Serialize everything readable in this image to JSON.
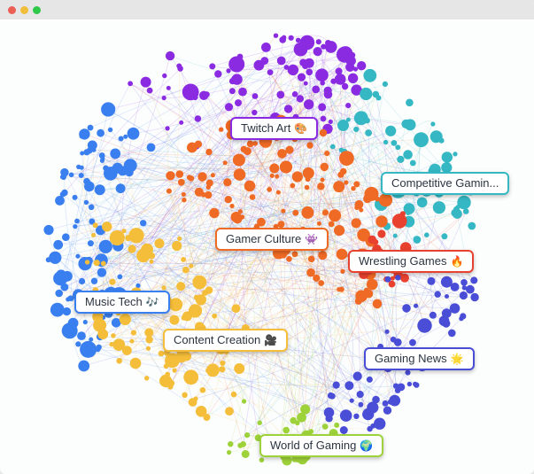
{
  "window": {
    "controls": [
      "close",
      "minimize",
      "maximize"
    ]
  },
  "clusters": [
    {
      "id": "twitch-art",
      "label": "Twitch Art",
      "emoji": "🎨",
      "color": "#8a2be2"
    },
    {
      "id": "competitive-gaming",
      "label": "Competitive Gamin...",
      "emoji": "",
      "color": "#35b8c4"
    },
    {
      "id": "gamer-culture",
      "label": "Gamer Culture",
      "emoji": "👾",
      "color": "#ef6a24"
    },
    {
      "id": "wrestling-games",
      "label": "Wrestling Games",
      "emoji": "🔥",
      "color": "#e8412f"
    },
    {
      "id": "music-tech",
      "label": "Music Tech",
      "emoji": "🎶",
      "color": "#3a7fef"
    },
    {
      "id": "content-creation",
      "label": "Content Creation",
      "emoji": "🎥",
      "color": "#f5be3a"
    },
    {
      "id": "gaming-news",
      "label": "Gaming News",
      "emoji": "🌟",
      "color": "#4a4dd6"
    },
    {
      "id": "world-of-gaming",
      "label": "World of Gaming",
      "emoji": "🌍",
      "color": "#9ed23a"
    }
  ]
}
